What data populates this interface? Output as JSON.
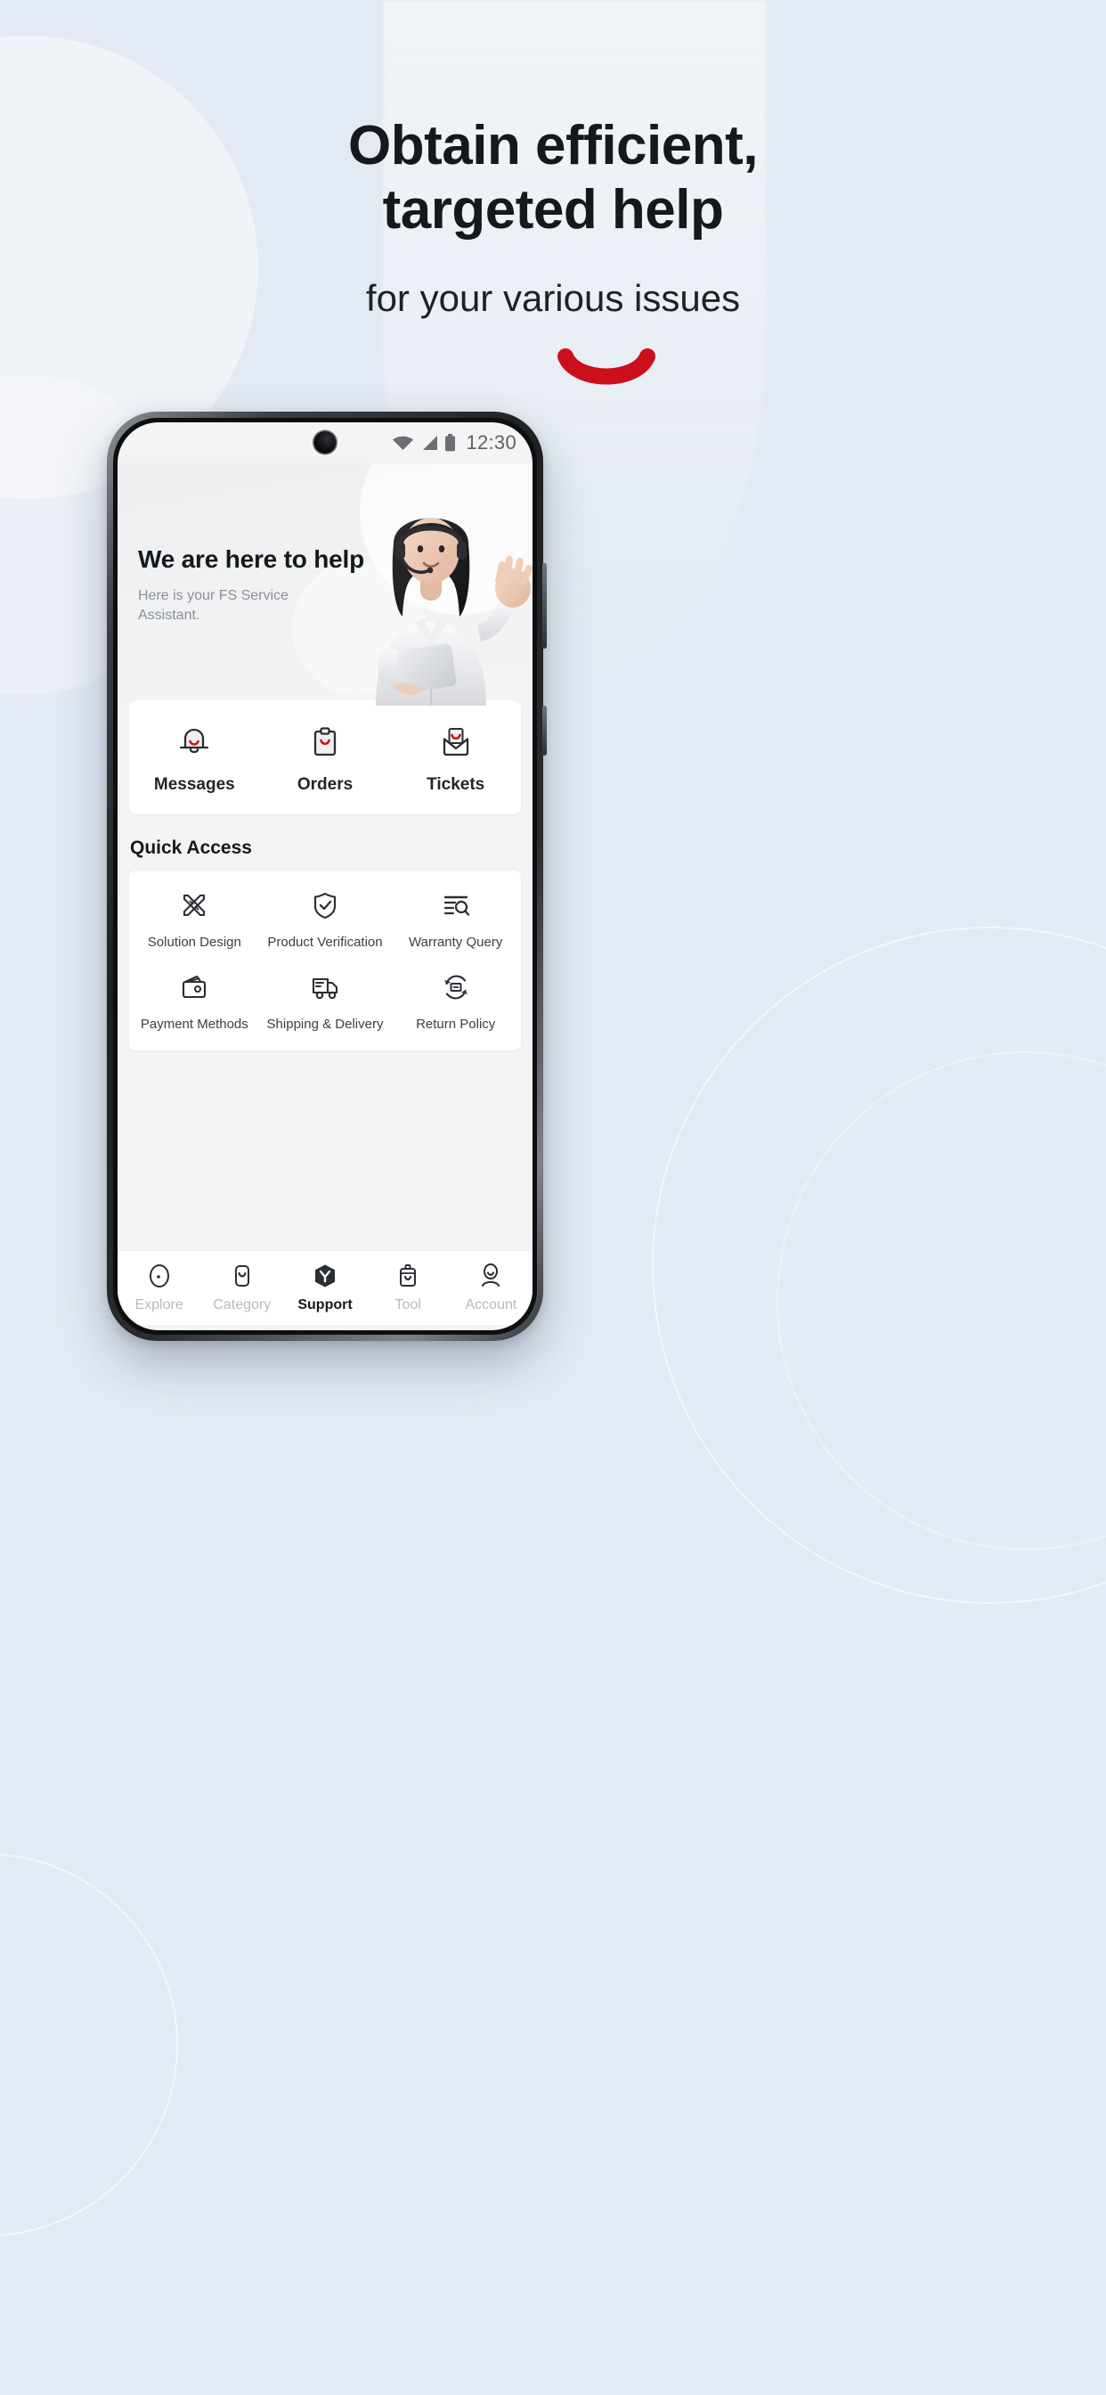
{
  "promo": {
    "headline_line1": "Obtain efficient,",
    "headline_line2": "targeted help",
    "subheadline": "for your various issues",
    "accent_color": "#CC1019",
    "background_color": "#E3EAF3",
    "accent_icon": "red-smile-swoosh"
  },
  "phone": {
    "status_bar": {
      "time": "12:30",
      "icons": [
        "wifi-icon",
        "cellular-signal-icon",
        "battery-icon"
      ]
    },
    "app_header": {
      "title": "We are here to help",
      "subtitle": "Here is your FS Service Assistant.",
      "illustration": "support-agent-illustration"
    },
    "quick_trio": [
      {
        "label": "Messages",
        "icon": "bell-smile-icon"
      },
      {
        "label": "Orders",
        "icon": "clipboard-smile-icon"
      },
      {
        "label": "Tickets",
        "icon": "envelope-smile-icon"
      }
    ],
    "quick_access": {
      "title": "Quick Access",
      "items": [
        {
          "label": "Solution Design",
          "icon": "crossed-pencil-ruler-icon"
        },
        {
          "label": "Product Verification",
          "icon": "shield-check-icon"
        },
        {
          "label": "Warranty Query",
          "icon": "list-search-icon"
        },
        {
          "label": "Payment Methods",
          "icon": "wallet-icon"
        },
        {
          "label": "Shipping & Delivery",
          "icon": "delivery-truck-icon"
        },
        {
          "label": "Return Policy",
          "icon": "return-box-icon"
        }
      ]
    },
    "tab_bar": {
      "active": "Support",
      "items": [
        {
          "label": "Explore",
          "icon": "compass-icon",
          "active": false
        },
        {
          "label": "Category",
          "icon": "category-smile-icon",
          "active": false
        },
        {
          "label": "Support",
          "icon": "support-hex-icon",
          "active": true
        },
        {
          "label": "Tool",
          "icon": "toolbox-smile-icon",
          "active": false
        },
        {
          "label": "Account",
          "icon": "account-person-icon",
          "active": false
        }
      ]
    }
  }
}
